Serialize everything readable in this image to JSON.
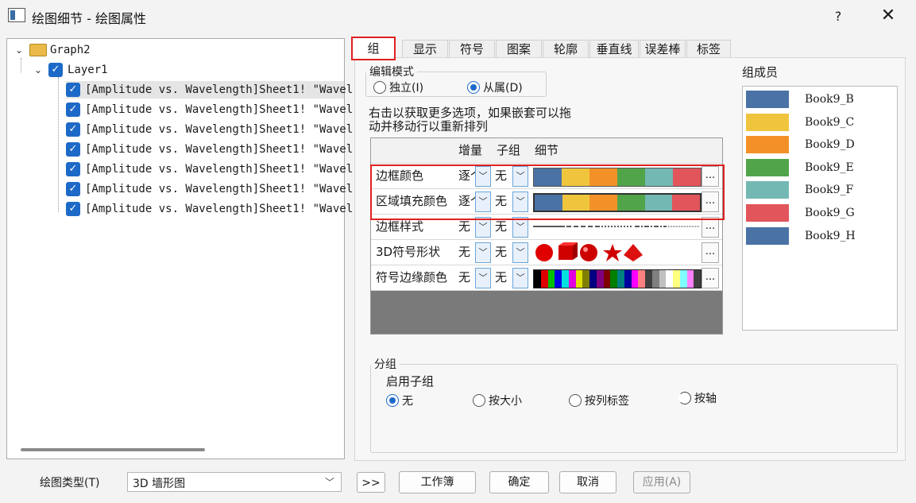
{
  "window": {
    "title": "绘图细节 - 绘图属性",
    "help": "?",
    "close": "✕"
  },
  "tree": {
    "root": "Graph2",
    "layer": "Layer1",
    "plots": [
      "[Amplitude vs. Wavelength]Sheet1! \"Wavel",
      "[Amplitude vs. Wavelength]Sheet1! \"Wavel",
      "[Amplitude vs. Wavelength]Sheet1! \"Wavel",
      "[Amplitude vs. Wavelength]Sheet1! \"Wavel",
      "[Amplitude vs. Wavelength]Sheet1! \"Wavel",
      "[Amplitude vs. Wavelength]Sheet1! \"Wavel",
      "[Amplitude vs. Wavelength]Sheet1! \"Wavel"
    ]
  },
  "tabs": [
    "组",
    "显示",
    "符号",
    "图案",
    "轮廓",
    "垂直线",
    "误差棒",
    "标签"
  ],
  "edit_mode": {
    "legend": "编辑模式",
    "independent": "独立(I)",
    "dependent": "从属(D)"
  },
  "hint": {
    "line1": "右击以获取更多选项，如果嵌套可以拖",
    "line2": "动并移动行以重新排列"
  },
  "grid": {
    "headers": {
      "increment": "增量",
      "subgroup": "子组",
      "detail": "细节"
    },
    "rows": [
      {
        "name": "边框颜色",
        "increment": "逐个",
        "subgroup": "无"
      },
      {
        "name": "区域填充颜色",
        "increment": "逐个",
        "subgroup": "无"
      },
      {
        "name": "边框样式",
        "increment": "无",
        "subgroup": "无"
      },
      {
        "name": "3D符号形状",
        "increment": "无",
        "subgroup": "无"
      },
      {
        "name": "符号边缘颜色",
        "increment": "无",
        "subgroup": "无"
      }
    ],
    "more": "...",
    "palette": [
      "#4a72a5",
      "#f0c53e",
      "#f39128",
      "#52a44a",
      "#73b8b3",
      "#e2555b"
    ]
  },
  "members": {
    "label": "组成员",
    "items": [
      {
        "name": "Book9_B",
        "color": "#4a72a5"
      },
      {
        "name": "Book9_C",
        "color": "#f0c53e"
      },
      {
        "name": "Book9_D",
        "color": "#f39128"
      },
      {
        "name": "Book9_E",
        "color": "#52a44a"
      },
      {
        "name": "Book9_F",
        "color": "#73b8b3"
      },
      {
        "name": "Book9_G",
        "color": "#e2555b"
      },
      {
        "name": "Book9_H",
        "color": "#4a72a5"
      }
    ]
  },
  "grouping": {
    "legend": "分组",
    "enable_subgroup": "启用子组",
    "none": "无",
    "by_size": "按大小",
    "by_column_label": "按列标签",
    "by_axis": "按轴"
  },
  "bottom": {
    "plot_type_label": "绘图类型(T)",
    "plot_type_value": "3D 墙形图",
    "expand": ">>",
    "workbook": "工作簿",
    "ok": "确定",
    "cancel": "取消",
    "apply": "应用(A)"
  }
}
